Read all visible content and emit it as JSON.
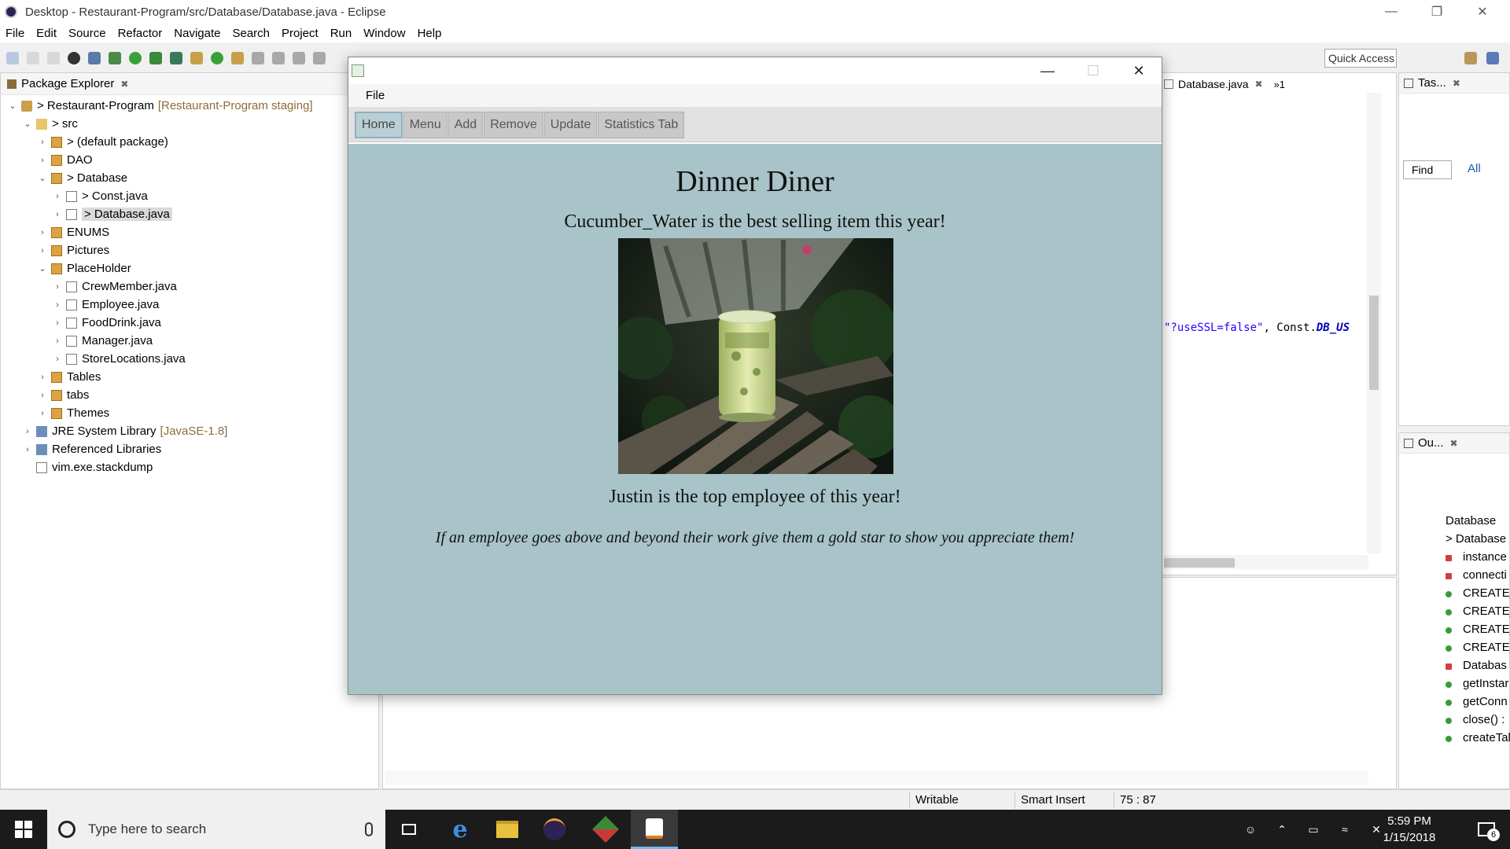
{
  "window": {
    "title": "Desktop - Restaurant-Program/src/Database/Database.java - Eclipse"
  },
  "menubar": [
    "File",
    "Edit",
    "Source",
    "Refactor",
    "Navigate",
    "Search",
    "Project",
    "Run",
    "Window",
    "Help"
  ],
  "toolbar": {
    "quick_access": "Quick Access"
  },
  "package_explorer": {
    "title": "Package Explorer",
    "tree": [
      {
        "label": "> Restaurant-Program",
        "extra": "[Restaurant-Program staging]",
        "depth": 0,
        "arrow": "⌄",
        "icon": "project-icon"
      },
      {
        "label": "> src",
        "depth": 1,
        "arrow": "⌄",
        "icon": "folder-icon"
      },
      {
        "label": "> (default package)",
        "depth": 2,
        "arrow": "›",
        "icon": "package-icon"
      },
      {
        "label": "DAO",
        "depth": 2,
        "arrow": "›",
        "icon": "package-icon"
      },
      {
        "label": "> Database",
        "depth": 2,
        "arrow": "⌄",
        "icon": "package-icon"
      },
      {
        "label": "> Const.java",
        "depth": 3,
        "arrow": "›",
        "icon": "java-file-icon"
      },
      {
        "label": "> Database.java",
        "depth": 3,
        "arrow": "›",
        "icon": "java-file-icon",
        "selected": true
      },
      {
        "label": "ENUMS",
        "depth": 2,
        "arrow": "›",
        "icon": "package-icon"
      },
      {
        "label": "Pictures",
        "depth": 2,
        "arrow": "›",
        "icon": "package-icon"
      },
      {
        "label": "PlaceHolder",
        "depth": 2,
        "arrow": "⌄",
        "icon": "package-icon"
      },
      {
        "label": "CrewMember.java",
        "depth": 3,
        "arrow": "›",
        "icon": "java-file-icon"
      },
      {
        "label": "Employee.java",
        "depth": 3,
        "arrow": "›",
        "icon": "java-file-icon"
      },
      {
        "label": "FoodDrink.java",
        "depth": 3,
        "arrow": "›",
        "icon": "java-file-icon"
      },
      {
        "label": "Manager.java",
        "depth": 3,
        "arrow": "›",
        "icon": "java-file-icon"
      },
      {
        "label": "StoreLocations.java",
        "depth": 3,
        "arrow": "›",
        "icon": "java-file-icon"
      },
      {
        "label": "Tables",
        "depth": 2,
        "arrow": "›",
        "icon": "package-icon"
      },
      {
        "label": "tabs",
        "depth": 2,
        "arrow": "›",
        "icon": "package-icon"
      },
      {
        "label": "Themes",
        "depth": 2,
        "arrow": "›",
        "icon": "package-icon"
      },
      {
        "label": "JRE System Library",
        "extra": "[JavaSE-1.8]",
        "depth": 1,
        "arrow": "›",
        "icon": "library-icon"
      },
      {
        "label": "Referenced Libraries",
        "depth": 1,
        "arrow": "›",
        "icon": "library-icon"
      },
      {
        "label": "vim.exe.stackdump",
        "depth": 1,
        "arrow": "",
        "icon": "file-icon"
      }
    ]
  },
  "editor": {
    "tab": "Database.java",
    "overflow": "»1",
    "code_str": "\"?useSSL=false\"",
    "code_sep": ", Const.",
    "code_const": "DB_US"
  },
  "tasks": {
    "title": "Tas...",
    "find": "Find",
    "all": "All"
  },
  "outline": {
    "title": "Ou...",
    "items": [
      "Database",
      "> Database",
      "instance",
      "connecti",
      "CREATE_",
      "CREATE_",
      "CREATE_",
      "CREATE_",
      "Databas",
      "getInstar",
      "getConn",
      "close() :",
      "createTal"
    ]
  },
  "statusbar": {
    "writable": "Writable",
    "insert": "Smart Insert",
    "position": "75 : 87"
  },
  "taskbar": {
    "search_placeholder": "Type here to search",
    "time": "5:59 PM",
    "date": "1/15/2018",
    "notifications": "6"
  },
  "app": {
    "menu": "File",
    "tabs": [
      "Home",
      "Menu",
      "Add",
      "Remove",
      "Update",
      "Statistics Tab"
    ],
    "active_tab": "Home",
    "title": "Dinner Diner",
    "best_seller": "Cucumber_Water is the best selling item this year!",
    "top_employee": "Justin is the top employee of this year!",
    "note": "If an employee goes above and beyond their work give them a gold star to show you appreciate them!",
    "background": "#a8c4c8"
  }
}
